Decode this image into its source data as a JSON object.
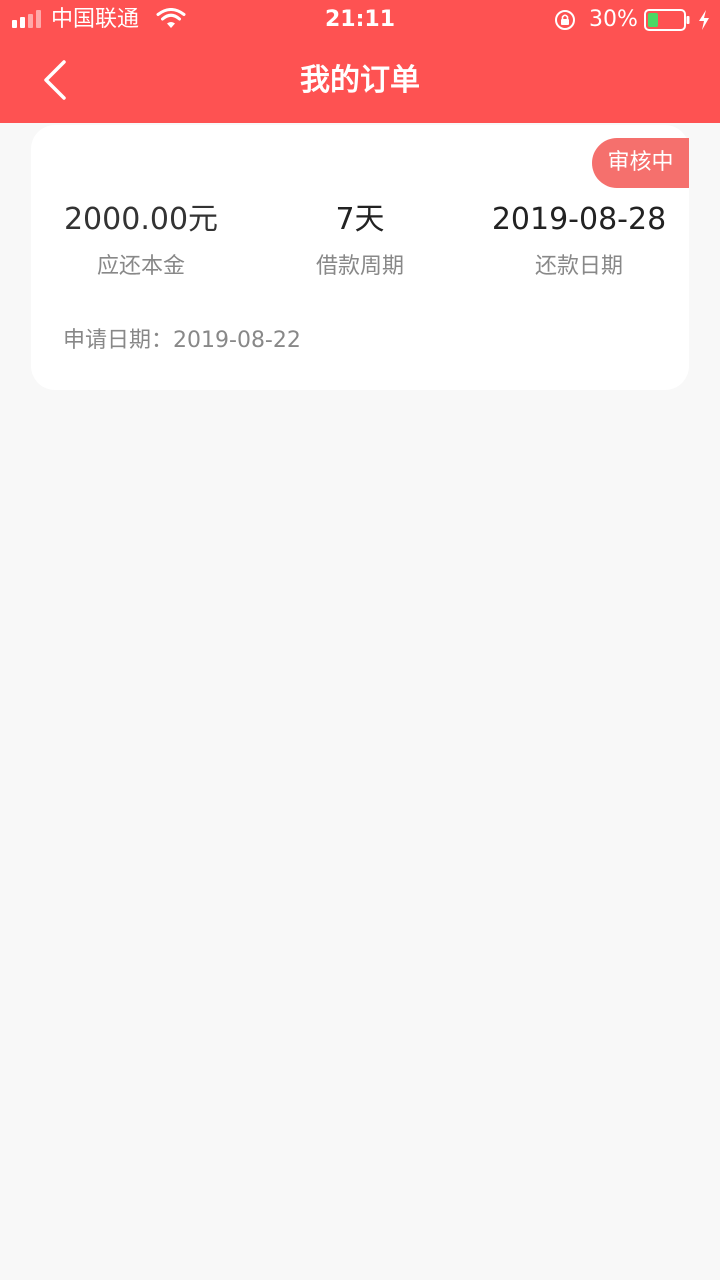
{
  "status_bar": {
    "carrier": "中国联通",
    "time": "21:11",
    "battery": "30%",
    "battery_level": 0.3
  },
  "nav": {
    "title": "我的订单"
  },
  "order": {
    "status": "审核中",
    "principal": "2000.00元",
    "principal_label": "应还本金",
    "term": "7天",
    "term_label": "借款周期",
    "due_date": "2019-08-28",
    "due_date_label": "还款日期",
    "apply_date_label": "申请日期：",
    "apply_date": "2019-08-22"
  },
  "colors": {
    "brand": "#fe5252",
    "badge": "#f5706d",
    "battery_fill": "#4cd964",
    "background": "#f8f8f8"
  }
}
